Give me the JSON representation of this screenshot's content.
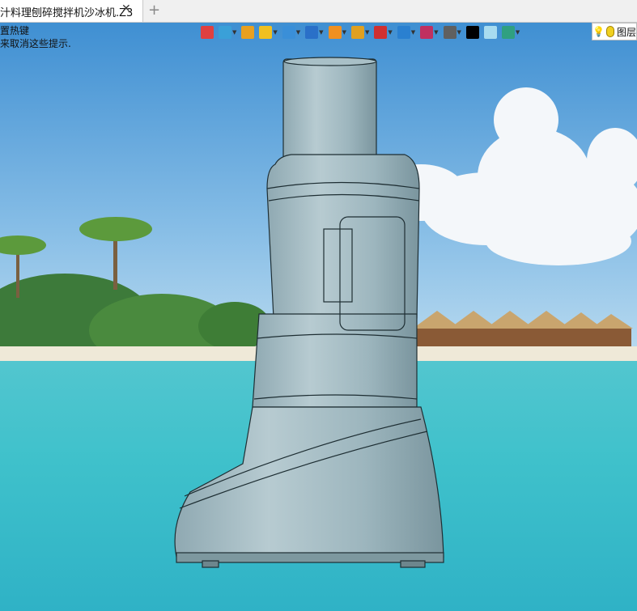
{
  "tab": {
    "title": "汁料理刨碎搅拌机沙冰机.Z3",
    "close": "✕",
    "add": "+"
  },
  "hint": {
    "line1": "置热键",
    "line2": "来取消这些提示."
  },
  "toolbar": {
    "buttons": [
      {
        "name": "view-restore-icon",
        "color": "#e04040"
      },
      {
        "name": "sketch-point-icon",
        "color": "#3aa0d8"
      },
      {
        "name": "pencil-icon",
        "color": "#e8a020"
      },
      {
        "name": "shaded-solid-icon",
        "color": "#f0c020"
      },
      {
        "name": "view-cube-icon",
        "color": "#3a8fd8"
      },
      {
        "name": "standard-views-icon",
        "color": "#2a70c8"
      },
      {
        "name": "render-mode-icon",
        "color": "#f09020"
      },
      {
        "name": "zoom-icon",
        "color": "#e0a020"
      },
      {
        "name": "axis-icon",
        "color": "#d03030"
      },
      {
        "name": "section-view-icon",
        "color": "#2a80d0"
      },
      {
        "name": "clip-plane-icon",
        "color": "#c03060"
      },
      {
        "name": "display-screen-icon",
        "color": "#606060"
      },
      {
        "name": "line-color-icon",
        "color": "#000000"
      },
      {
        "name": "fill-color-icon",
        "color": "#a8dcf0"
      },
      {
        "name": "layer-visibility-icon",
        "color": "#30a080"
      }
    ]
  },
  "layer": {
    "label": "图层"
  }
}
